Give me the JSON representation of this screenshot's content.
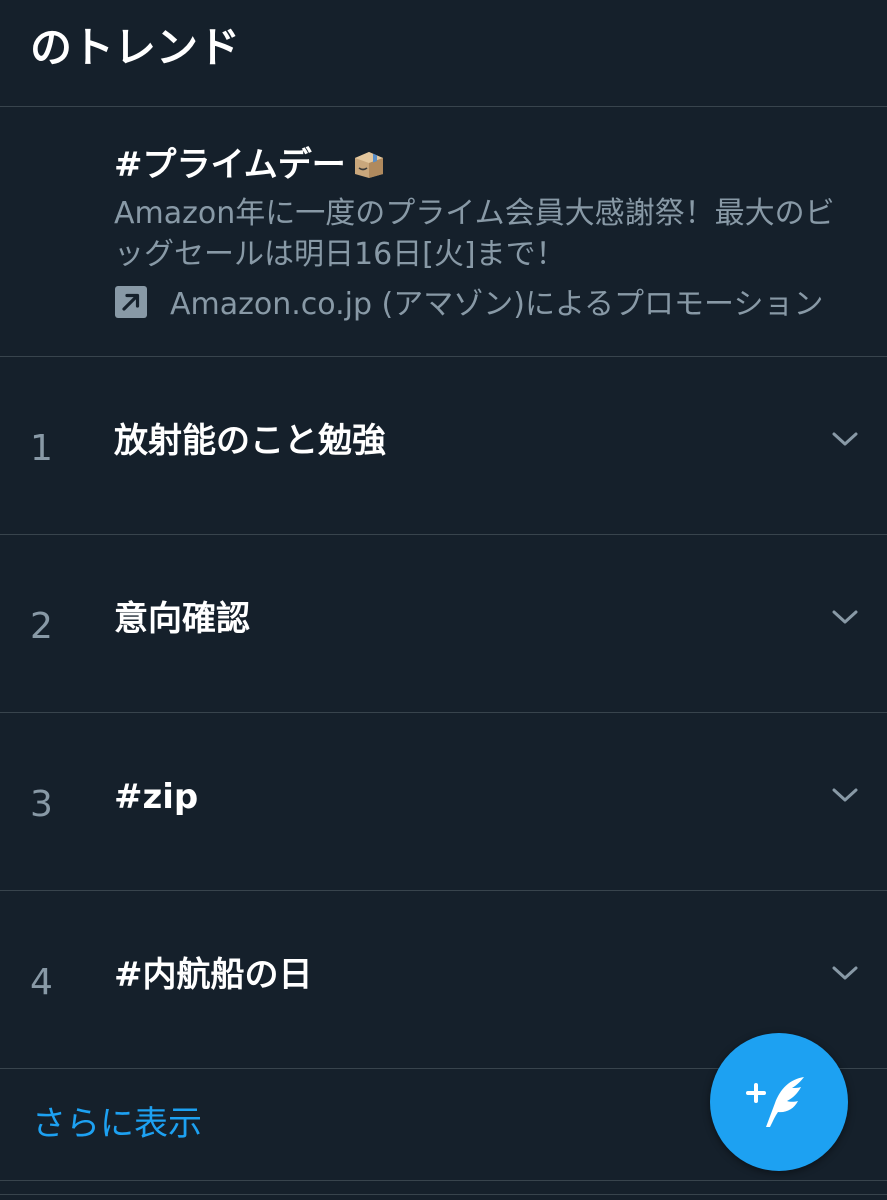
{
  "header": {
    "title": "のトレンド"
  },
  "promoted": {
    "title": "#プライムデー",
    "icon": "package-box-icon",
    "description": "Amazon年に一度のプライム会員大感謝祭！最大のビッグセールは明日16日[火]まで！",
    "source_icon": "promoted-arrow-icon",
    "source": "Amazon.co.jp (アマゾン)によるプロモーション"
  },
  "trends": [
    {
      "rank": "1",
      "name": "放射能のこと勉強"
    },
    {
      "rank": "2",
      "name": "意向確認"
    },
    {
      "rank": "3",
      "name": "#zip"
    },
    {
      "rank": "4",
      "name": "#内航船の日"
    }
  ],
  "show_more": {
    "label": "さらに表示"
  },
  "fab": {
    "icon": "compose-tweet-icon"
  },
  "colors": {
    "background": "#15202b",
    "divider": "#38444d",
    "secondary_text": "#8899a6",
    "accent": "#1da1f2"
  }
}
